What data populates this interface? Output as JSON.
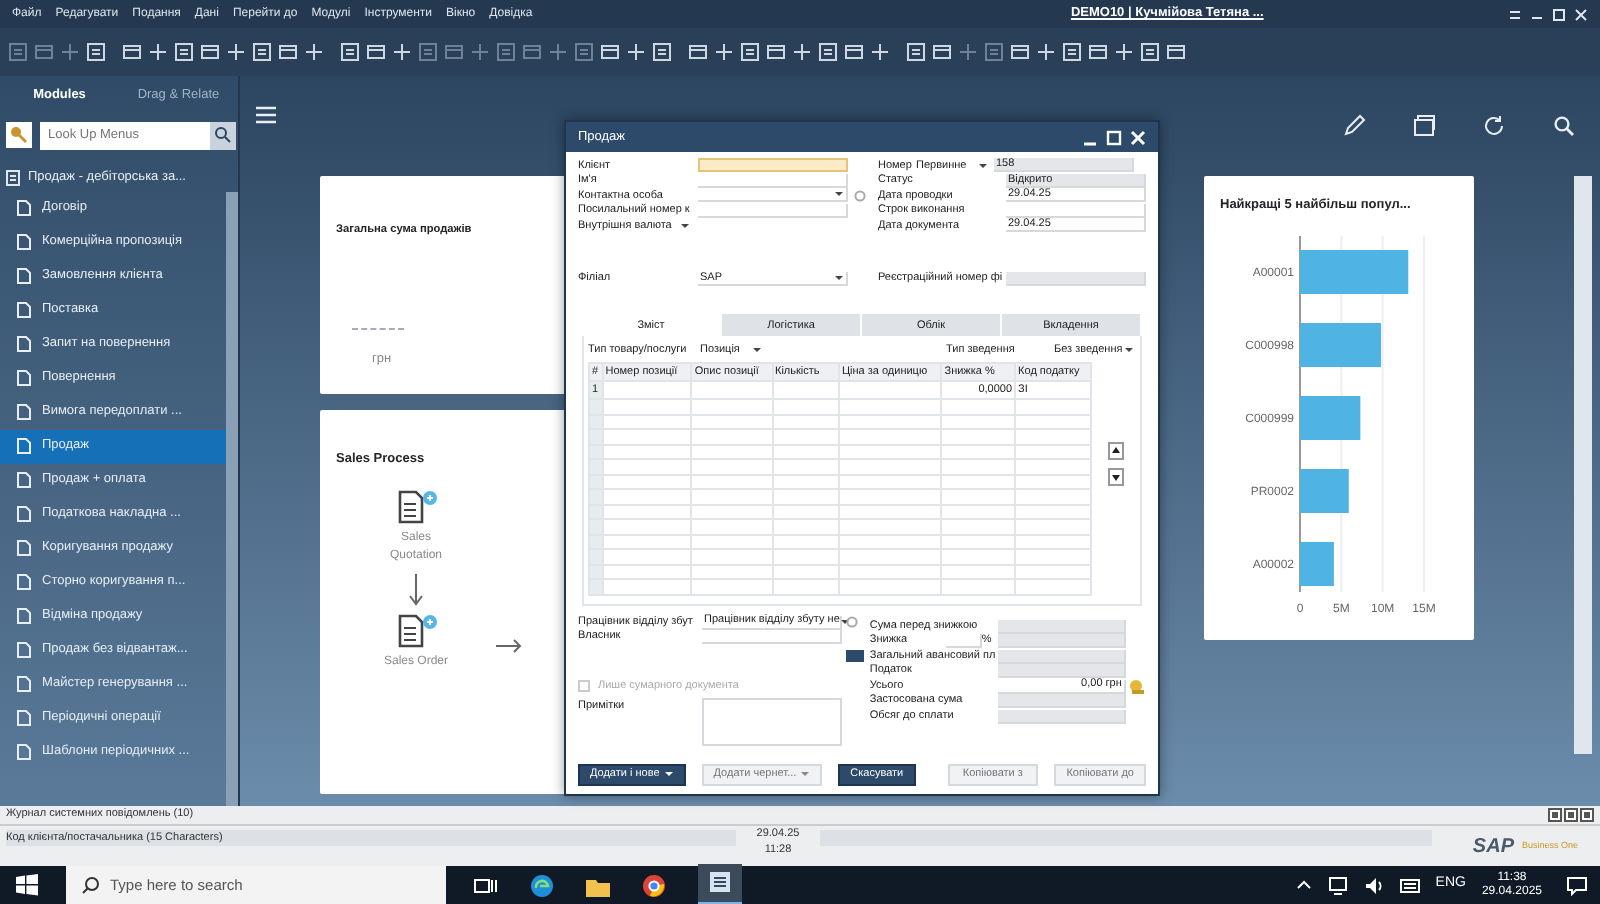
{
  "menu_bar": {
    "items": [
      "Файл",
      "Редагувати",
      "Подання",
      "Дані",
      "Перейти до",
      "Модулі",
      "Інструменти",
      "Вікно",
      "Довідка"
    ],
    "title": "DEMO10 | Кучмійова Тетяна ..."
  },
  "sidebar": {
    "tabs": [
      {
        "label": "Modules",
        "selected": true
      },
      {
        "label": "Drag & Relate",
        "selected": false
      }
    ],
    "search": {
      "placeholder": "Look Up Menus"
    },
    "module": "Продаж - дебіторська за...",
    "items": [
      {
        "label": "Договір",
        "selected": false
      },
      {
        "label": "Комерційна пропозиція",
        "selected": false
      },
      {
        "label": "Замовлення клієнта",
        "selected": false
      },
      {
        "label": "Поставка",
        "selected": false
      },
      {
        "label": "Запит на повернення",
        "selected": false
      },
      {
        "label": "Повернення",
        "selected": false
      },
      {
        "label": "Вимога передоплати ...",
        "selected": false
      },
      {
        "label": "Продаж",
        "selected": true
      },
      {
        "label": "Продаж + оплата",
        "selected": false
      },
      {
        "label": "Податкова накладна ...",
        "selected": false
      },
      {
        "label": "Коригування продажу",
        "selected": false
      },
      {
        "label": "Сторно коригування п...",
        "selected": false
      },
      {
        "label": "Відміна продажу",
        "selected": false
      },
      {
        "label": "Продаж без відвантаж...",
        "selected": false
      },
      {
        "label": "Майстер генерування ...",
        "selected": false
      },
      {
        "label": "Періодичні операції",
        "selected": false
      },
      {
        "label": "Шаблони періодичних ...",
        "selected": false
      }
    ]
  },
  "total_sales_card": {
    "title": "Загальна сума продажів",
    "currency": "грн"
  },
  "sales_process": {
    "title": "Sales Process",
    "steps": [
      {
        "label": "Sales Quotation"
      },
      {
        "label": "Sales Order"
      }
    ]
  },
  "chart_card": {
    "title": "Найкращі 5 найбільш попул...",
    "chart_data": {
      "type": "bar",
      "orientation": "horizontal",
      "categories": [
        "A00001",
        "C000998",
        "C000999",
        "PR0002",
        "A00002"
      ],
      "series": [
        {
          "color": "#4fb3e3",
          "values": [
            13100000,
            9800000,
            7300000,
            5900000,
            4100000
          ]
        }
      ],
      "xlim": [
        0,
        15000000
      ],
      "xticks": [
        {
          "value": 0,
          "label": "0"
        },
        {
          "value": 5000000,
          "label": "5M"
        },
        {
          "value": 10000000,
          "label": "10M"
        },
        {
          "value": 15000000,
          "label": "15M"
        }
      ]
    }
  },
  "dialog": {
    "title": "Продаж",
    "header_left": [
      {
        "label": "Клієнт",
        "kind": "text",
        "focused": true
      },
      {
        "label": "Ім'я",
        "kind": "text",
        "focused": false
      },
      {
        "label": "Контактна особа",
        "kind": "dropdown",
        "focused": false
      },
      {
        "label": "Посилальний номер к",
        "kind": "text",
        "focused": false
      },
      {
        "label": "Внутрішня валюта",
        "kind": "label-dropdown",
        "focused": false
      }
    ],
    "header_right": [
      {
        "label": "Номер",
        "series": "Первинне",
        "value": "158",
        "readonly": true
      },
      {
        "label": "Статус",
        "value": "Відкрито",
        "readonly": true
      },
      {
        "label": "Дата проводки",
        "value": "29.04.25",
        "readonly": false
      },
      {
        "label": "Строк виконання",
        "readonly": false
      },
      {
        "label": "Дата документа",
        "value": "29.04.25",
        "readonly": false
      }
    ],
    "branch": {
      "label": "Філіал",
      "value": "SAP"
    },
    "registration": {
      "label": "Реєстраційний номер фі"
    },
    "tabs": [
      {
        "label": "Зміст",
        "selected": true
      },
      {
        "label": "Логістика",
        "selected": false
      },
      {
        "label": "Облік",
        "selected": false
      },
      {
        "label": "Вкладення",
        "selected": false
      }
    ],
    "item_type": {
      "label": "Тип товару/послуги",
      "value": "Позиція"
    },
    "summary_type": {
      "label": "Тип зведення",
      "value": "Без зведення"
    },
    "columns": [
      "#",
      "Номер позиції",
      "Опис позиції",
      "Кількість",
      "Ціна за одиницю",
      "Знижка %",
      "Код податку"
    ],
    "rows": [
      {
        "number": "1",
        "discount": "0,0000",
        "tax_code": "ЗІ"
      }
    ],
    "sales_employee": {
      "label": "Працівник відділу збут",
      "value": "Працівник відділу збуту не"
    },
    "owner": {
      "label": "Власник"
    },
    "summary_only": {
      "label": "Лише сумарного документа",
      "checked": false,
      "disabled": true
    },
    "remarks": {
      "label": "Примітки"
    },
    "totals": [
      {
        "label": "Сума перед знижкою",
        "kind": "readonly"
      },
      {
        "label": "Знижка",
        "kind": "percent",
        "unit": "%"
      },
      {
        "label": "Загальний авансовий пл",
        "kind": "advance"
      },
      {
        "label": "Податок",
        "kind": "readonly"
      },
      {
        "label": "Усього",
        "kind": "total",
        "value": "0,00 грн"
      },
      {
        "label": "Застосована сума",
        "kind": "readonly"
      },
      {
        "label": "Обсяг до сплати",
        "kind": "readonly"
      }
    ],
    "buttons_left": [
      {
        "label": "Додати і нове",
        "disabled": false,
        "dropdown": true
      },
      {
        "label": "Додати чернет...",
        "disabled": true,
        "dropdown": true
      },
      {
        "label": "Скасувати",
        "disabled": false,
        "dropdown": false
      }
    ],
    "buttons_right": [
      {
        "label": "Копіювати з",
        "disabled": true,
        "dropdown": false
      },
      {
        "label": "Копіювати до",
        "disabled": true,
        "dropdown": false
      }
    ]
  },
  "status_bar": {
    "message_log": "Журнал системних повідомлень (10)",
    "field_hint": "Код клієнта/постачальника (15 Characters)",
    "date": "29.04.25",
    "time": "11:28",
    "logo": "SAP",
    "logo_subtitle": "Business One"
  },
  "taskbar": {
    "search": {
      "placeholder": "Type here to search"
    },
    "language": "ENG",
    "time": "11:38",
    "date": "29.04.2025"
  }
}
